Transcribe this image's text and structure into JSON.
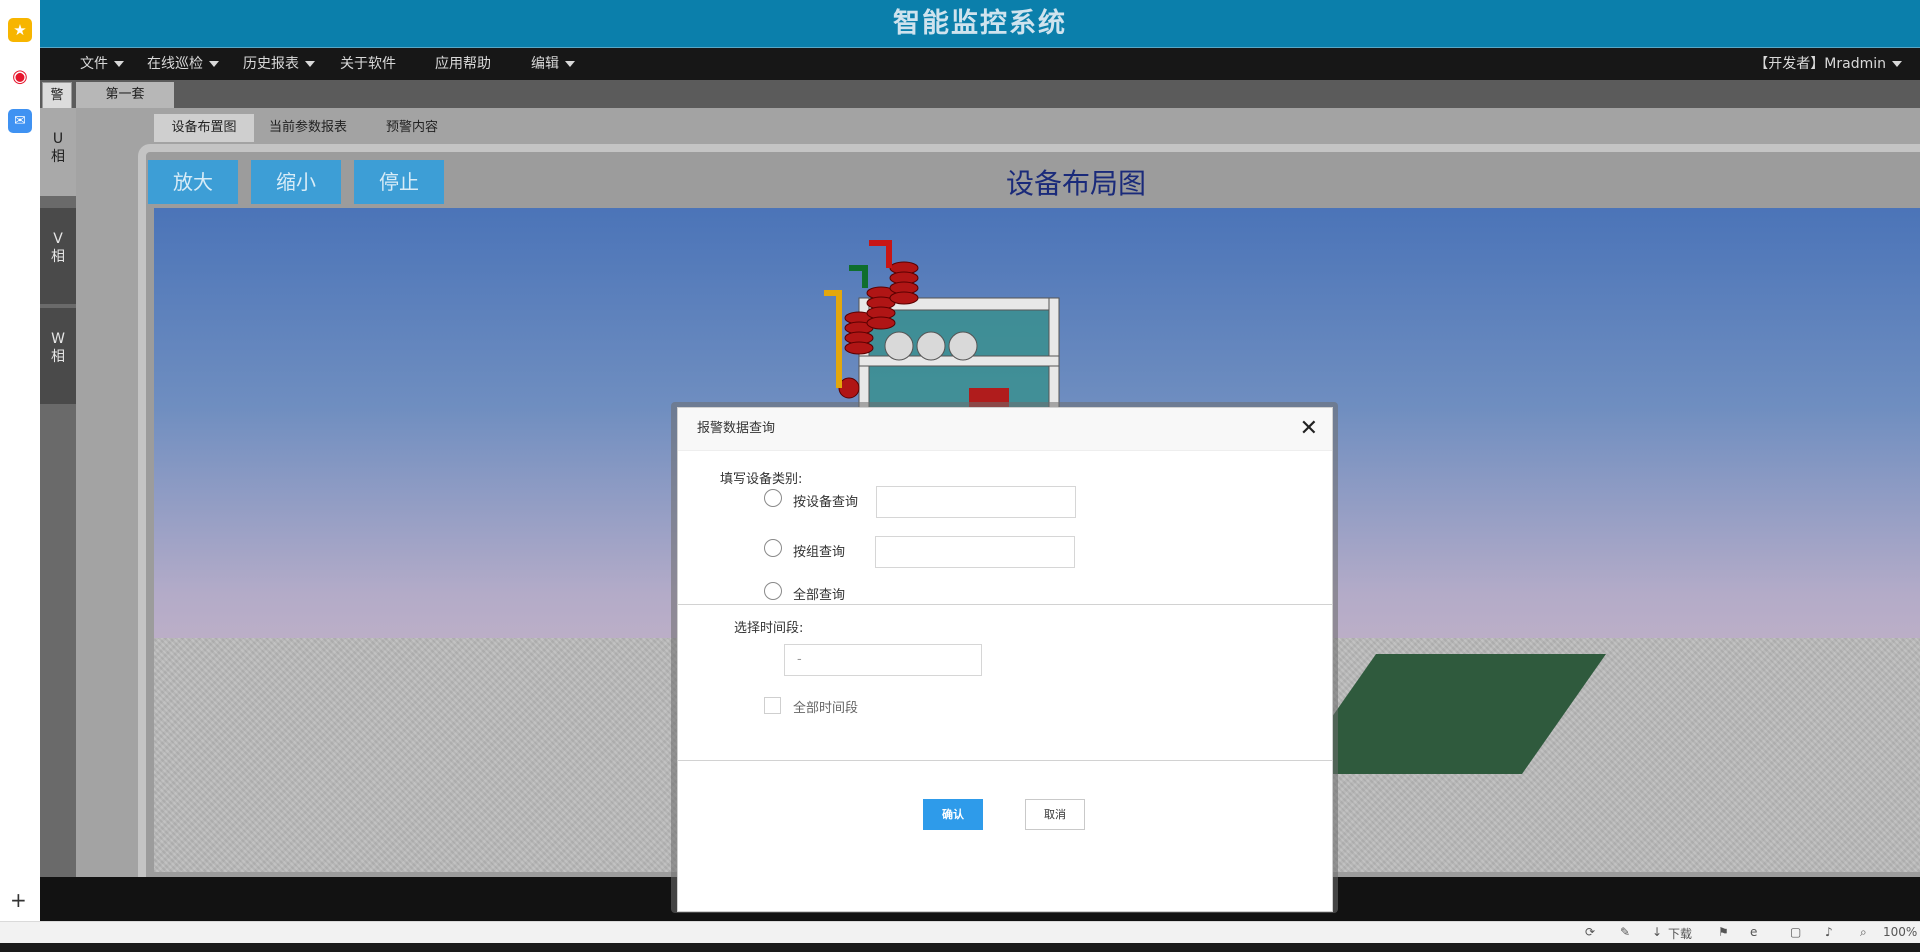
{
  "app": {
    "title": "智能监控系统"
  },
  "menu": {
    "items": [
      {
        "label": "文件",
        "dropdown": true
      },
      {
        "label": "在线巡检",
        "dropdown": true
      },
      {
        "label": "历史报表",
        "dropdown": true
      },
      {
        "label": "关于软件",
        "dropdown": false
      },
      {
        "label": "应用帮助",
        "dropdown": false
      },
      {
        "label": "编辑",
        "dropdown": true
      }
    ],
    "user": "【开发者】Mradmin"
  },
  "top_tabs": {
    "alarm": "警",
    "set1": "第一套"
  },
  "phases": {
    "u": "U\n相",
    "v": "V\n相",
    "w": "W\n相"
  },
  "sub_tabs": [
    "设备布置图",
    "当前参数报表",
    "预警内容"
  ],
  "panel": {
    "zoom_in": "放大",
    "zoom_out": "缩小",
    "stop": "停止",
    "title": "设备布局图"
  },
  "modal": {
    "title": "报警数据查询",
    "device_type_label": "填写设备类别:",
    "options": [
      "按设备查询",
      "按组查询",
      "全部查询"
    ],
    "time_label": "选择时间段:",
    "time_placeholder": "-",
    "all_time_label": "全部时间段",
    "confirm": "确认",
    "cancel": "取消"
  },
  "statusbar": {
    "download": "下载",
    "zoom": "100%"
  },
  "colors": {
    "titlebar": "#0b7fab",
    "primary_button": "#2e9bea",
    "control_button": "#3d9ed6"
  }
}
